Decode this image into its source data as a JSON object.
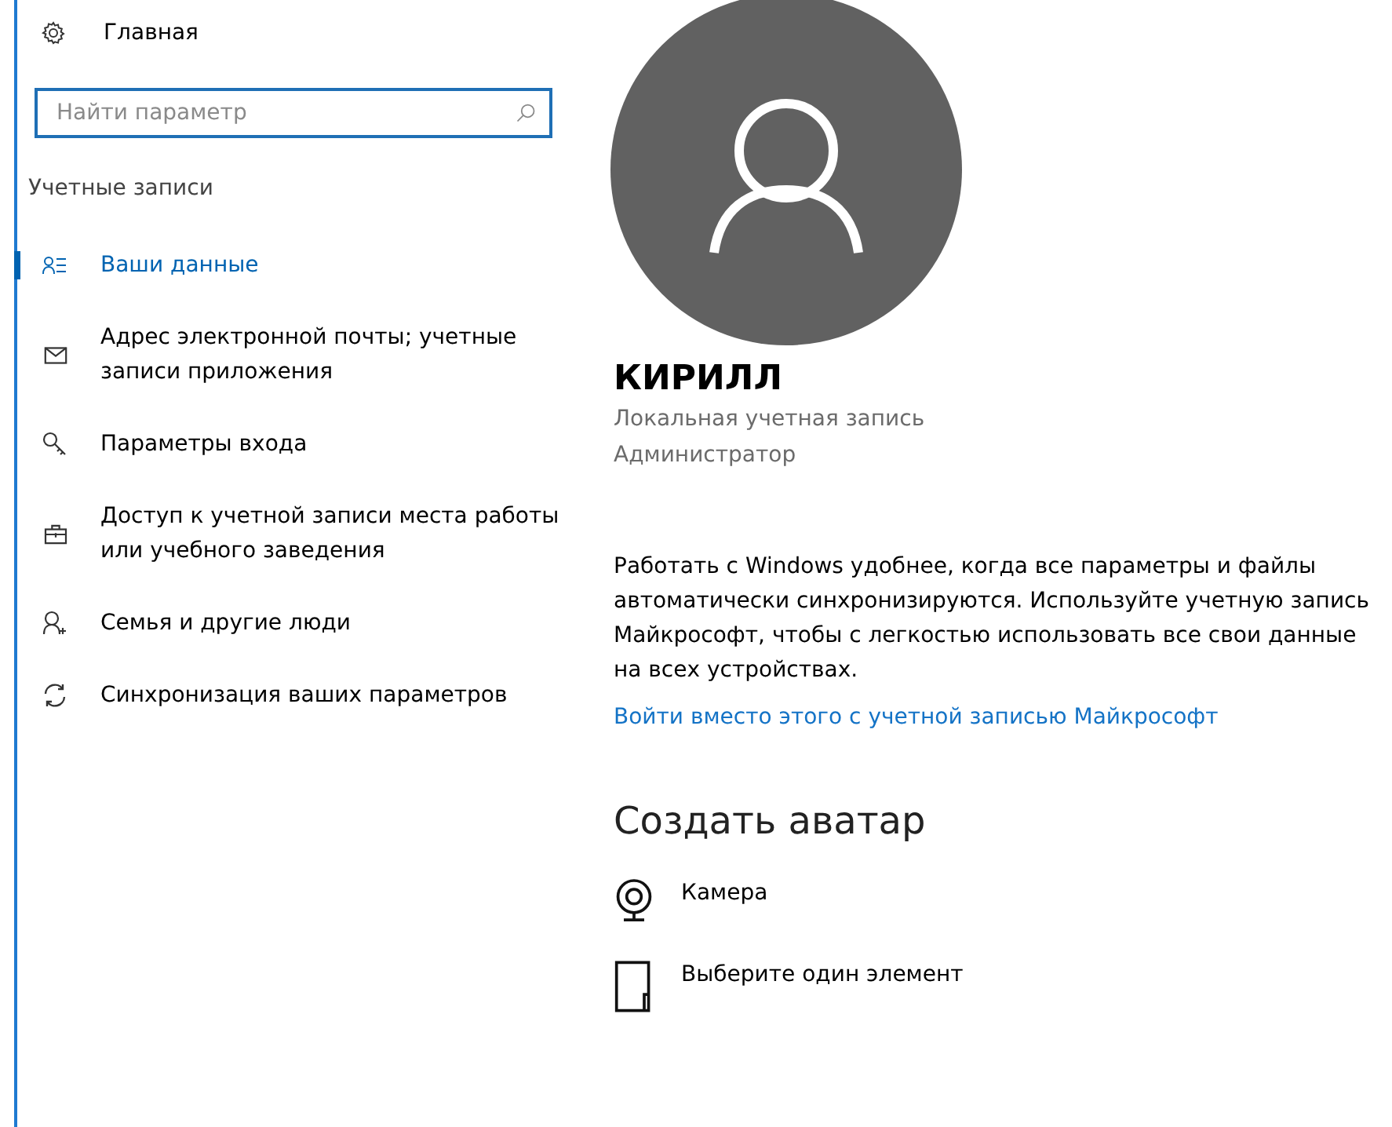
{
  "home": {
    "label": "Главная"
  },
  "search": {
    "placeholder": "Найти параметр"
  },
  "section_title": "Учетные записи",
  "nav_items": [
    {
      "label": "Ваши данные",
      "selected": true
    },
    {
      "label": "Адрес электронной почты; учетные записи приложения",
      "selected": false
    },
    {
      "label": "Параметры входа",
      "selected": false
    },
    {
      "label": "Доступ к учетной записи места работы или учебного заведения",
      "selected": false
    },
    {
      "label": "Семья и другие люди",
      "selected": false
    },
    {
      "label": "Синхронизация ваших параметров",
      "selected": false
    }
  ],
  "profile": {
    "name": "КИРИЛЛ",
    "account_type": "Локальная учетная запись",
    "role": "Администратор"
  },
  "description": "Работать с Windows удобнее, когда все параметры и файлы автоматически синхронизируются. Используйте учетную запись Майкрософт, чтобы с легкостью использовать все свои данные на всех устройствах.",
  "link": "Войти вместо этого с учетной записью Майкрософт",
  "avatar_section": {
    "title": "Создать аватар",
    "options": [
      {
        "label": "Камера"
      },
      {
        "label": "Выберите один элемент"
      }
    ]
  }
}
